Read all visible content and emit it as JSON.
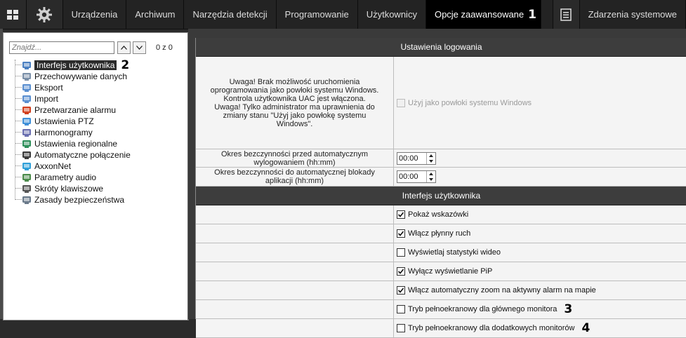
{
  "topbar": {
    "tabs": [
      {
        "label": "Urządzenia"
      },
      {
        "label": "Archiwum"
      },
      {
        "label": "Narzędzia detekcji"
      },
      {
        "label": "Programowanie"
      },
      {
        "label": "Użytkownicy"
      },
      {
        "label": "Opcje zaawansowane"
      }
    ],
    "active_marker": "1",
    "events_tab": "Zdarzenia systemowe"
  },
  "left": {
    "search_placeholder": "Znajdź...",
    "match_count": "0 z 0",
    "tree": [
      {
        "label": "Interfejs użytkownika",
        "icon": "monitor-icon",
        "selected": true,
        "marker": "2"
      },
      {
        "label": "Przechowywanie danych",
        "icon": "storage-icon"
      },
      {
        "label": "Eksport",
        "icon": "export-icon"
      },
      {
        "label": "Import",
        "icon": "import-icon"
      },
      {
        "label": "Przetwarzanie alarmu",
        "icon": "alarm-icon"
      },
      {
        "label": "Ustawienia PTZ",
        "icon": "ptz-icon"
      },
      {
        "label": "Harmonogramy",
        "icon": "schedule-icon"
      },
      {
        "label": "Ustawienia regionalne",
        "icon": "globe-icon"
      },
      {
        "label": "Automatyczne połączenie",
        "icon": "connection-icon"
      },
      {
        "label": "AxxonNet",
        "icon": "cloud-icon"
      },
      {
        "label": "Parametry audio",
        "icon": "audio-icon"
      },
      {
        "label": "Skróty klawiszowe",
        "icon": "keyboard-icon"
      },
      {
        "label": "Zasady bezpieczeństwa",
        "icon": "security-icon"
      }
    ]
  },
  "logging": {
    "header": "Ustawienia logowania",
    "shell_warning": "Uwaga! Brak możliwość uruchomienia oprogramowania jako powłoki systemu Windows. Kontrola użytkownika UAC jest włączona.\nUwaga! Tylko administrator ma uprawnienia do zmiany stanu \"Użyj jako powłokę systemu Windows\".",
    "shell_checkbox": "Użyj jako powłoki systemu Windows",
    "autologout_label": "Okres bezczynności przed automatycznym wylogowaniem (hh:mm)",
    "autologout_value": "00:00",
    "autolock_label": "Okres bezczynności do automatycznej blokady aplikacji (hh:mm)",
    "autolock_value": "00:00"
  },
  "ui": {
    "header": "Interfejs użytkownika",
    "options": [
      {
        "label": "Pokaż wskazówki",
        "checked": true
      },
      {
        "label": "Włącz płynny ruch",
        "checked": true
      },
      {
        "label": "Wyświetlaj statystyki wideo",
        "checked": false
      },
      {
        "label": "Wyłącz wyświetlanie PiP",
        "checked": true
      },
      {
        "label": "Włącz automatyczny zoom na aktywny alarm na mapie",
        "checked": true
      },
      {
        "label": "Tryb pełnoekranowy dla głównego monitora",
        "checked": false,
        "marker": "3"
      },
      {
        "label": "Tryb pełnoekranowy dla dodatkowych monitorów",
        "checked": false,
        "marker": "4"
      }
    ]
  }
}
